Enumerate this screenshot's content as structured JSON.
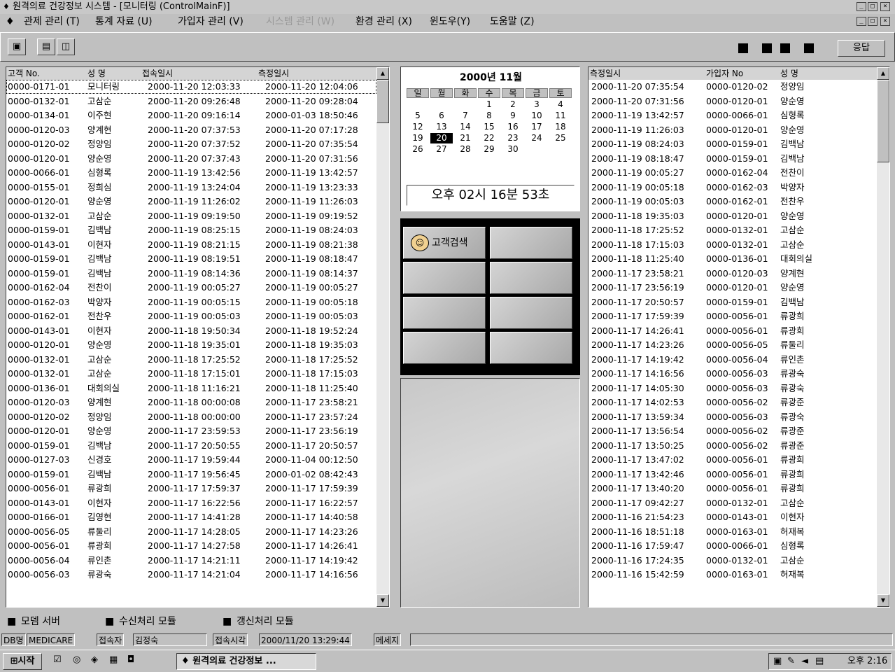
{
  "window": {
    "title": "원격의료 건강정보 시스템 - [모니터링 (ControlMainF)]"
  },
  "menu": [
    {
      "label": "관제 관리 (T)",
      "enabled": true
    },
    {
      "label": "통계 자료 (U)",
      "enabled": true
    },
    {
      "label": "가입자 관리 (V)",
      "enabled": true
    },
    {
      "label": "시스템 관리 (W)",
      "enabled": false
    },
    {
      "label": "환경 관리 (X)",
      "enabled": true
    },
    {
      "label": "윈도우(Y)",
      "enabled": true
    },
    {
      "label": "도움말 (Z)",
      "enabled": true
    }
  ],
  "toolbar": {
    "respond_label": "응답"
  },
  "left_table": {
    "headers": [
      "고객 No.",
      "성 명",
      "접속일시",
      "측정일시"
    ],
    "rows": [
      [
        "0000-0171-01",
        "모니터링",
        "2000-11-20 12:03:33",
        "2000-11-20 12:04:06"
      ],
      [
        "0000-0132-01",
        "고삼순",
        "2000-11-20 09:26:48",
        "2000-11-20 09:28:04"
      ],
      [
        "0000-0134-01",
        "이주현",
        "2000-11-20 09:16:14",
        "2000-01-03 18:50:46"
      ],
      [
        "0000-0120-03",
        "양계현",
        "2000-11-20 07:37:53",
        "2000-11-20 07:17:28"
      ],
      [
        "0000-0120-02",
        "정양임",
        "2000-11-20 07:37:52",
        "2000-11-20 07:35:54"
      ],
      [
        "0000-0120-01",
        "양순영",
        "2000-11-20 07:37:43",
        "2000-11-20 07:31:56"
      ],
      [
        "0000-0066-01",
        "심형록",
        "2000-11-19 13:42:56",
        "2000-11-19 13:42:57"
      ],
      [
        "0000-0155-01",
        "정희심",
        "2000-11-19 13:24:04",
        "2000-11-19 13:23:33"
      ],
      [
        "0000-0120-01",
        "양순영",
        "2000-11-19 11:26:02",
        "2000-11-19 11:26:03"
      ],
      [
        "0000-0132-01",
        "고삼순",
        "2000-11-19 09:19:50",
        "2000-11-19 09:19:52"
      ],
      [
        "0000-0159-01",
        "김백남",
        "2000-11-19 08:25:15",
        "2000-11-19 08:24:03"
      ],
      [
        "0000-0143-01",
        "이현자",
        "2000-11-19 08:21:15",
        "2000-11-19 08:21:38"
      ],
      [
        "0000-0159-01",
        "김백남",
        "2000-11-19 08:19:51",
        "2000-11-19 08:18:47"
      ],
      [
        "0000-0159-01",
        "김백남",
        "2000-11-19 08:14:36",
        "2000-11-19 08:14:37"
      ],
      [
        "0000-0162-04",
        "전찬이",
        "2000-11-19 00:05:27",
        "2000-11-19 00:05:27"
      ],
      [
        "0000-0162-03",
        "박양자",
        "2000-11-19 00:05:15",
        "2000-11-19 00:05:18"
      ],
      [
        "0000-0162-01",
        "전찬우",
        "2000-11-19 00:05:03",
        "2000-11-19 00:05:03"
      ],
      [
        "0000-0143-01",
        "이현자",
        "2000-11-18 19:50:34",
        "2000-11-18 19:52:24"
      ],
      [
        "0000-0120-01",
        "양순영",
        "2000-11-18 19:35:01",
        "2000-11-18 19:35:03"
      ],
      [
        "0000-0132-01",
        "고삼순",
        "2000-11-18 17:25:52",
        "2000-11-18 17:25:52"
      ],
      [
        "0000-0132-01",
        "고삼순",
        "2000-11-18 17:15:01",
        "2000-11-18 17:15:03"
      ],
      [
        "0000-0136-01",
        "대회의실",
        "2000-11-18 11:16:21",
        "2000-11-18 11:25:40"
      ],
      [
        "0000-0120-03",
        "양계현",
        "2000-11-18 00:00:08",
        "2000-11-17 23:58:21"
      ],
      [
        "0000-0120-02",
        "정양임",
        "2000-11-18 00:00:00",
        "2000-11-17 23:57:24"
      ],
      [
        "0000-0120-01",
        "양순영",
        "2000-11-17 23:59:53",
        "2000-11-17 23:56:19"
      ],
      [
        "0000-0159-01",
        "김백남",
        "2000-11-17 20:50:55",
        "2000-11-17 20:50:57"
      ],
      [
        "0000-0127-03",
        "신경호",
        "2000-11-17 19:59:44",
        "2000-11-04 00:12:50"
      ],
      [
        "0000-0159-01",
        "김백남",
        "2000-11-17 19:56:45",
        "2000-01-02 08:42:43"
      ],
      [
        "0000-0056-01",
        "류광희",
        "2000-11-17 17:59:37",
        "2000-11-17 17:59:39"
      ],
      [
        "0000-0143-01",
        "이현자",
        "2000-11-17 16:22:56",
        "2000-11-17 16:22:57"
      ],
      [
        "0000-0166-01",
        "김영현",
        "2000-11-17 14:41:28",
        "2000-11-17 14:40:58"
      ],
      [
        "0000-0056-05",
        "류둘리",
        "2000-11-17 14:28:05",
        "2000-11-17 14:23:26"
      ],
      [
        "0000-0056-01",
        "류광희",
        "2000-11-17 14:27:58",
        "2000-11-17 14:26:41"
      ],
      [
        "0000-0056-04",
        "류인촌",
        "2000-11-17 14:21:11",
        "2000-11-17 14:19:42"
      ],
      [
        "0000-0056-03",
        "류광숙",
        "2000-11-17 14:21:04",
        "2000-11-17 14:16:56"
      ]
    ]
  },
  "calendar": {
    "title": "2000년 11월",
    "weekdays": [
      "일",
      "월",
      "화",
      "수",
      "목",
      "금",
      "토"
    ],
    "weeks": [
      [
        "",
        "",
        "",
        "1",
        "2",
        "3",
        "4"
      ],
      [
        "5",
        "6",
        "7",
        "8",
        "9",
        "10",
        "11"
      ],
      [
        "12",
        "13",
        "14",
        "15",
        "16",
        "17",
        "18"
      ],
      [
        "19",
        "20",
        "21",
        "22",
        "23",
        "24",
        "25"
      ],
      [
        "26",
        "27",
        "28",
        "29",
        "30",
        "",
        ""
      ]
    ],
    "today": "20"
  },
  "clock": {
    "text": "오후 02시 16분 53초"
  },
  "grid_buttons": {
    "customer_search_label": "고객검색"
  },
  "right_table": {
    "headers": [
      "측정일시",
      "가입자 No",
      "성 명"
    ],
    "rows": [
      [
        "2000-11-20 07:35:54",
        "0000-0120-02",
        "정양임"
      ],
      [
        "2000-11-20 07:31:56",
        "0000-0120-01",
        "양순영"
      ],
      [
        "2000-11-19 13:42:57",
        "0000-0066-01",
        "심형록"
      ],
      [
        "2000-11-19 11:26:03",
        "0000-0120-01",
        "양순영"
      ],
      [
        "2000-11-19 08:24:03",
        "0000-0159-01",
        "김백남"
      ],
      [
        "2000-11-19 08:18:47",
        "0000-0159-01",
        "김백남"
      ],
      [
        "2000-11-19 00:05:27",
        "0000-0162-04",
        "전찬이"
      ],
      [
        "2000-11-19 00:05:18",
        "0000-0162-03",
        "박양자"
      ],
      [
        "2000-11-19 00:05:03",
        "0000-0162-01",
        "전찬우"
      ],
      [
        "2000-11-18 19:35:03",
        "0000-0120-01",
        "양순영"
      ],
      [
        "2000-11-18 17:25:52",
        "0000-0132-01",
        "고삼순"
      ],
      [
        "2000-11-18 17:15:03",
        "0000-0132-01",
        "고삼순"
      ],
      [
        "2000-11-18 11:25:40",
        "0000-0136-01",
        "대회의실"
      ],
      [
        "2000-11-17 23:58:21",
        "0000-0120-03",
        "양계현"
      ],
      [
        "2000-11-17 23:56:19",
        "0000-0120-01",
        "양순영"
      ],
      [
        "2000-11-17 20:50:57",
        "0000-0159-01",
        "김백남"
      ],
      [
        "2000-11-17 17:59:39",
        "0000-0056-01",
        "류광희"
      ],
      [
        "2000-11-17 14:26:41",
        "0000-0056-01",
        "류광희"
      ],
      [
        "2000-11-17 14:23:26",
        "0000-0056-05",
        "류둘리"
      ],
      [
        "2000-11-17 14:19:42",
        "0000-0056-04",
        "류인촌"
      ],
      [
        "2000-11-17 14:16:56",
        "0000-0056-03",
        "류광숙"
      ],
      [
        "2000-11-17 14:05:30",
        "0000-0056-03",
        "류광숙"
      ],
      [
        "2000-11-17 14:02:53",
        "0000-0056-02",
        "류광준"
      ],
      [
        "2000-11-17 13:59:34",
        "0000-0056-03",
        "류광숙"
      ],
      [
        "2000-11-17 13:56:54",
        "0000-0056-02",
        "류광준"
      ],
      [
        "2000-11-17 13:50:25",
        "0000-0056-02",
        "류광준"
      ],
      [
        "2000-11-17 13:47:02",
        "0000-0056-01",
        "류광희"
      ],
      [
        "2000-11-17 13:42:46",
        "0000-0056-01",
        "류광희"
      ],
      [
        "2000-11-17 13:40:20",
        "0000-0056-01",
        "류광희"
      ],
      [
        "2000-11-17 09:42:27",
        "0000-0132-01",
        "고삼순"
      ],
      [
        "2000-11-16 21:54:23",
        "0000-0143-01",
        "이현자"
      ],
      [
        "2000-11-16 18:51:18",
        "0000-0163-01",
        "허재복"
      ],
      [
        "2000-11-16 17:59:47",
        "0000-0066-01",
        "심형록"
      ],
      [
        "2000-11-16 17:24:35",
        "0000-0132-01",
        "고삼순"
      ],
      [
        "2000-11-16 15:42:59",
        "0000-0163-01",
        "허재복"
      ]
    ]
  },
  "legend": [
    "모뎀 서버",
    "수신처리 모듈",
    "갱신처리 모듈"
  ],
  "status_bar": {
    "db_label": "DB명",
    "db_value": "MEDICARE",
    "user_label": "접속자",
    "user_value": "김정숙",
    "time_label": "접속시각",
    "time_value": "2000/11/20 13:29:44",
    "message_label": "메세지"
  },
  "taskbar": {
    "start_label": "시작",
    "task_label": "원격의료 건강정보 ...",
    "clock": "오후 2:16"
  }
}
